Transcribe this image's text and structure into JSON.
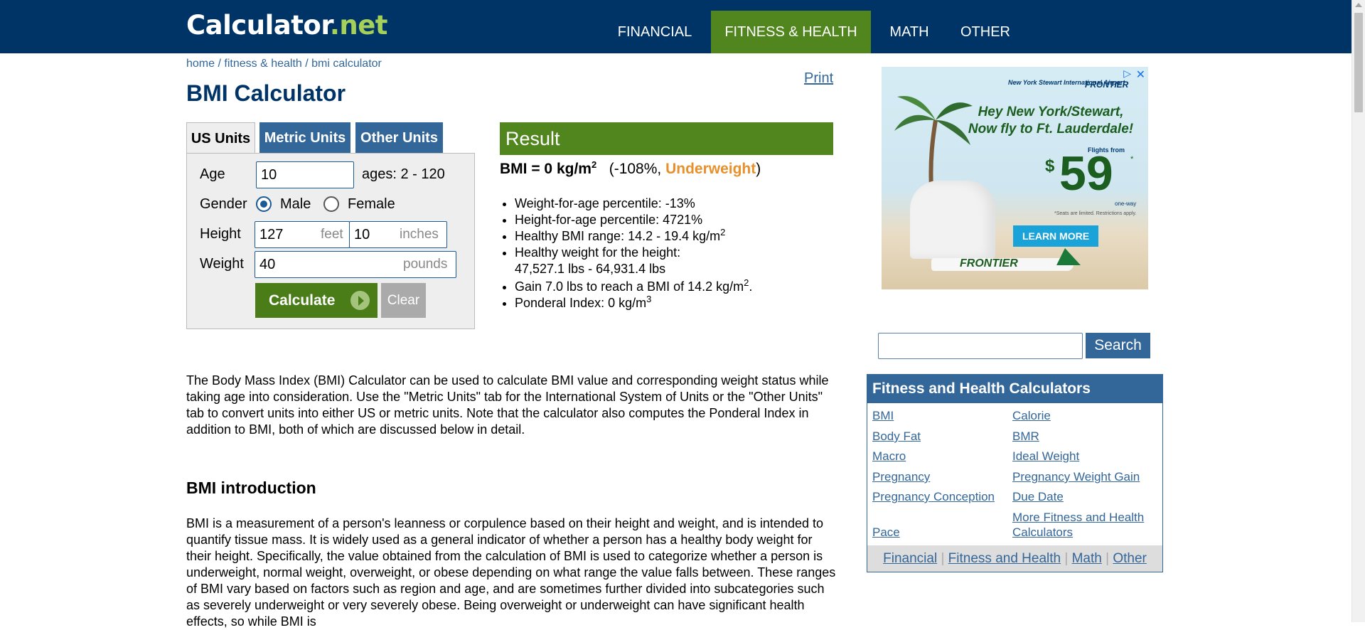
{
  "header": {
    "logo": {
      "part1": "Calculator",
      "part2": ".",
      "part3": "net"
    },
    "nav": [
      {
        "label": "FINANCIAL",
        "active": false
      },
      {
        "label": "FITNESS & HEALTH",
        "active": true
      },
      {
        "label": "MATH",
        "active": false
      },
      {
        "label": "OTHER",
        "active": false
      }
    ],
    "colors": {
      "bar": "#003366",
      "active_tab": "#51861e",
      "logo_accent": "#a5d05a"
    }
  },
  "breadcrumb": {
    "items": [
      "home",
      "fitness & health",
      "bmi calculator"
    ],
    "separator": "/"
  },
  "page_title": "BMI Calculator",
  "print_label": "Print",
  "calculator": {
    "tabs": [
      {
        "label": "US Units",
        "active": true
      },
      {
        "label": "Metric Units",
        "active": false
      },
      {
        "label": "Other Units",
        "active": false
      }
    ],
    "age": {
      "label": "Age",
      "value": "10",
      "hint": "ages: 2 - 120"
    },
    "gender": {
      "label": "Gender",
      "options": [
        "Male",
        "Female"
      ],
      "selected": "Male"
    },
    "height": {
      "label": "Height",
      "feet_value": "127",
      "feet_unit": "feet",
      "inches_value": "10",
      "inches_unit": "inches"
    },
    "weight": {
      "label": "Weight",
      "value": "40",
      "unit": "pounds"
    },
    "calculate_label": "Calculate",
    "clear_label": "Clear"
  },
  "result": {
    "header": "Result",
    "bmi_text": "BMI = 0 kg/m",
    "bmi_exp": "2",
    "percent": "(-108%, ",
    "status": "Underweight",
    "close_paren": ")",
    "items": [
      {
        "text": "Weight-for-age percentile: -13%"
      },
      {
        "text": "Height-for-age percentile: 4721%"
      },
      {
        "text": "Healthy BMI range: 14.2 - 19.4 kg/m",
        "sup": "2"
      },
      {
        "text": "Healthy weight for the height:",
        "text2": "47,527.1 lbs - 64,931.4 lbs"
      },
      {
        "text": "Gain 7.0 lbs to reach a BMI of 14.2 kg/m",
        "sup": "2",
        "after": "."
      },
      {
        "text": "Ponderal Index: 0 kg/m",
        "sup": "3"
      }
    ],
    "colors": {
      "header": "#51861e",
      "status": "#e8912c"
    }
  },
  "content": {
    "intro": "The Body Mass Index (BMI) Calculator can be used to calculate BMI value and corresponding weight status while taking age into consideration. Use the \"Metric Units\" tab for the International System of Units or the \"Other Units\" tab to convert units into either US or metric units. Note that the calculator also computes the Ponderal Index in addition to BMI, both of which are discussed below in detail.",
    "section_heading": "BMI introduction",
    "section_para": "BMI is a measurement of a person's leanness or corpulence based on their height and weight, and is intended to quantify tissue mass. It is widely used as a general indicator of whether a person has a healthy body weight for their height. Specifically, the value obtained from the calculation of BMI is used to categorize whether a person is underweight, normal weight, overweight, or obese depending on what range the value falls between. These ranges of BMI vary based on factors such as region and age, and are sometimes further divided into subcategories such as severely underweight or very severely obese. Being overweight or underweight can have significant health effects, so while BMI is"
  },
  "ad": {
    "airport": "New York Stewart International Airport",
    "brand": "FRONTIER",
    "headline": "Hey New York/Stewart, Now fly to Ft. Lauderdale!",
    "flights_from": "Flights from",
    "currency": "$",
    "price": "59",
    "star": "*",
    "one_way": "one-way",
    "fine_print": "*Seats are limited. Restrictions apply.",
    "cta": "LEARN MORE",
    "plane_logo": "FRONTIER",
    "info_icon": "ad-choices-icon",
    "close_icon": "close-icon"
  },
  "search": {
    "placeholder": "",
    "button_label": "Search"
  },
  "sidebar": {
    "title": "Fitness and Health Calculators",
    "links": [
      "BMI",
      "Calorie",
      "Body Fat",
      "BMR",
      "Macro",
      "Ideal Weight",
      "Pregnancy",
      "Pregnancy Weight Gain",
      "Pregnancy Conception",
      "Due Date",
      "Pace",
      "More Fitness and Health Calculators"
    ],
    "footer": [
      "Financial",
      "Fitness and Health",
      "Math",
      "Other"
    ],
    "footer_separator": "|"
  }
}
